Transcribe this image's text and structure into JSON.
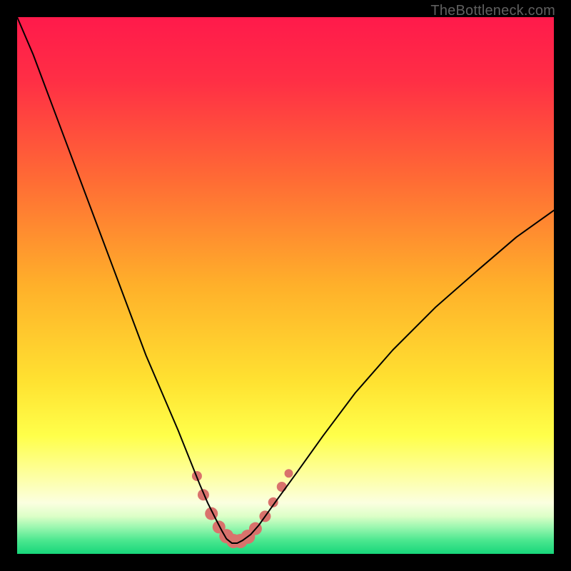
{
  "watermark": "TheBottleneck.com",
  "chart_data": {
    "type": "line",
    "title": "",
    "xlabel": "",
    "ylabel": "",
    "xlim": [
      0,
      100
    ],
    "ylim": [
      0,
      100
    ],
    "background_gradient": {
      "stops": [
        {
          "offset": 0,
          "color": "#ff1a4b"
        },
        {
          "offset": 0.12,
          "color": "#ff2f45"
        },
        {
          "offset": 0.3,
          "color": "#ff6a35"
        },
        {
          "offset": 0.5,
          "color": "#ffb02a"
        },
        {
          "offset": 0.68,
          "color": "#ffe231"
        },
        {
          "offset": 0.78,
          "color": "#ffff4a"
        },
        {
          "offset": 0.86,
          "color": "#fdffa8"
        },
        {
          "offset": 0.905,
          "color": "#fbffe0"
        },
        {
          "offset": 0.93,
          "color": "#dcffc7"
        },
        {
          "offset": 0.95,
          "color": "#9cf7b0"
        },
        {
          "offset": 0.975,
          "color": "#4be78f"
        },
        {
          "offset": 1.0,
          "color": "#17d67a"
        }
      ]
    },
    "series": [
      {
        "name": "bottleneck-curve",
        "color": "#000000",
        "stroke_width": 2,
        "x": [
          0,
          3,
          6,
          9,
          12,
          15,
          18,
          21,
          24,
          27,
          30,
          32,
          34,
          35.5,
          37,
          38.2,
          39,
          40,
          41,
          42,
          43.5,
          45,
          48,
          52,
          57,
          63,
          70,
          78,
          86,
          93,
          100
        ],
        "y": [
          100,
          93,
          85,
          77,
          69,
          61,
          53,
          45,
          37,
          30,
          23,
          18,
          13,
          9.5,
          6.5,
          4.2,
          2.8,
          2.0,
          2.0,
          2.5,
          3.6,
          5.3,
          9.5,
          15,
          22,
          30,
          38,
          46,
          53,
          59,
          64
        ]
      }
    ],
    "markers": {
      "color": "#d9726c",
      "points": [
        {
          "x": 33.5,
          "y": 14.5,
          "r": 7
        },
        {
          "x": 34.7,
          "y": 11.0,
          "r": 8
        },
        {
          "x": 36.2,
          "y": 7.5,
          "r": 9
        },
        {
          "x": 37.6,
          "y": 5.0,
          "r": 9
        },
        {
          "x": 39.0,
          "y": 3.3,
          "r": 10
        },
        {
          "x": 40.3,
          "y": 2.4,
          "r": 10
        },
        {
          "x": 41.6,
          "y": 2.4,
          "r": 10
        },
        {
          "x": 43.0,
          "y": 3.2,
          "r": 10
        },
        {
          "x": 44.4,
          "y": 4.7,
          "r": 9
        },
        {
          "x": 46.2,
          "y": 7.0,
          "r": 8
        },
        {
          "x": 47.7,
          "y": 9.6,
          "r": 7
        },
        {
          "x": 49.3,
          "y": 12.5,
          "r": 7
        },
        {
          "x": 50.6,
          "y": 15.0,
          "r": 6
        }
      ]
    }
  }
}
